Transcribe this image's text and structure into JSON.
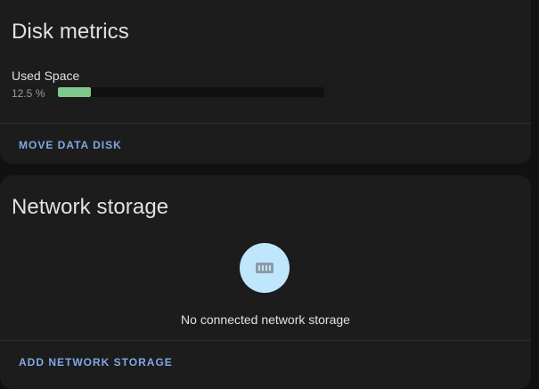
{
  "disk_metrics": {
    "title": "Disk metrics",
    "used_space": {
      "label": "Used Space",
      "value_text": "12.5 %",
      "percent": 12.5
    },
    "move_button_label": "MOVE DATA DISK"
  },
  "network_storage": {
    "title": "Network storage",
    "icon": "nas-icon",
    "empty_message": "No connected network storage",
    "add_button_label": "ADD NETWORK STORAGE"
  },
  "colors": {
    "progress_fill": "#7fc98c",
    "accent_button": "#7fa8e6",
    "icon_circle": "#bfe6fb"
  }
}
